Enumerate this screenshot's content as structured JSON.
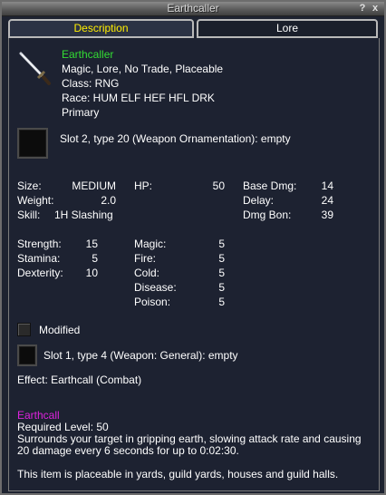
{
  "window": {
    "title": "Earthcaller",
    "help_glyph": "?",
    "close_glyph": "x"
  },
  "tabs": [
    {
      "label": "Description",
      "active": true
    },
    {
      "label": "Lore",
      "active": false
    }
  ],
  "item": {
    "icon": "sword-icon",
    "name": "Earthcaller",
    "flags": "Magic, Lore, No Trade, Placeable",
    "class": "Class: RNG",
    "race": "Race: HUM ELF HEF HFL DRK",
    "slot": "Primary"
  },
  "augment_slot": {
    "text": "Slot 2, type 20 (Weapon Ornamentation): empty"
  },
  "stats_block1": {
    "size_label": "Size:",
    "size_value": "MEDIUM",
    "weight_label": "Weight:",
    "weight_value": "2.0",
    "skill_label": "Skill:",
    "skill_value": "1H Slashing",
    "hp_label": "HP:",
    "hp_value": "50",
    "base_dmg_label": "Base Dmg:",
    "base_dmg_value": "14",
    "delay_label": "Delay:",
    "delay_value": "24",
    "dmg_bon_label": "Dmg Bon:",
    "dmg_bon_value": "39"
  },
  "stats_block2": {
    "str_label": "Strength:",
    "str_value": "15",
    "sta_label": "Stamina:",
    "sta_value": "5",
    "dex_label": "Dexterity:",
    "dex_value": "10",
    "magic_label": "Magic:",
    "magic_value": "5",
    "fire_label": "Fire:",
    "fire_value": "5",
    "cold_label": "Cold:",
    "cold_value": "5",
    "disease_label": "Disease:",
    "disease_value": "5",
    "poison_label": "Poison:",
    "poison_value": "5"
  },
  "modified": {
    "label": "Modified",
    "checked": false
  },
  "general_slot": {
    "text": "Slot 1, type 4 (Weapon: General): empty"
  },
  "effect": {
    "text": "Effect: Earthcall (Combat)"
  },
  "spell": {
    "name": "Earthcall",
    "required_level": "Required Level: 50",
    "desc_line1": "Surrounds your target in gripping earth, slowing attack rate and causing",
    "desc_line2": "20 damage every 6 seconds for up to 0:02:30."
  },
  "placeable_note": "This item is placeable in yards, guild yards, houses and guild halls.",
  "colors": {
    "name": "#33dd33",
    "spell": "#dd22dd",
    "active_tab": "#ffee00",
    "background": "#1d2231"
  }
}
